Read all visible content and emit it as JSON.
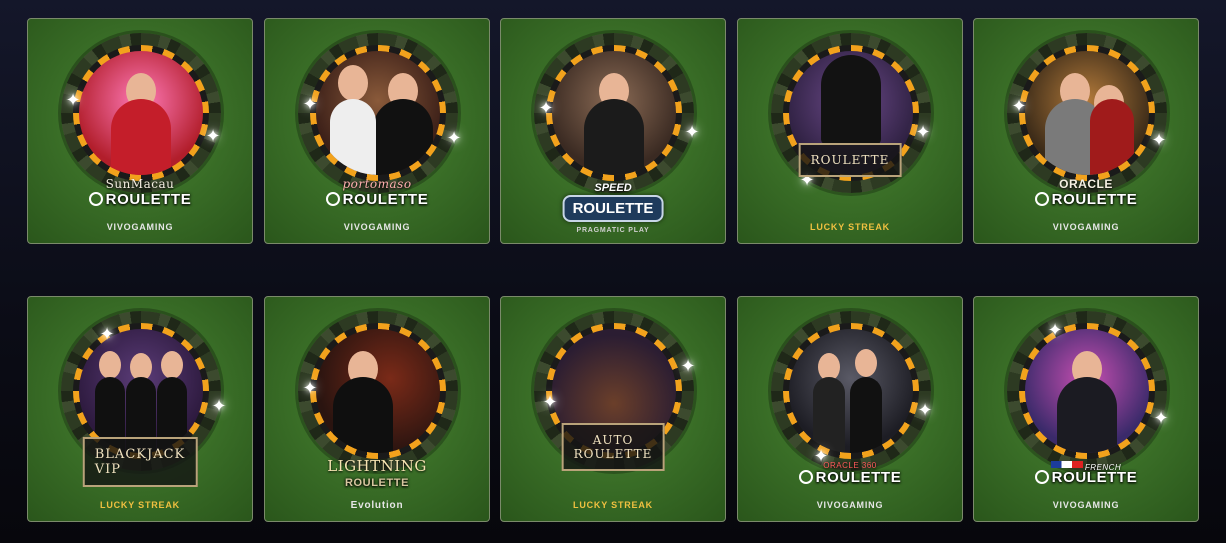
{
  "games": [
    {
      "title_top": "SunMacau",
      "title_main": "ROULETTE",
      "provider": "VIVOGAMING",
      "style": "plain",
      "photo_bg": "#b21e2b",
      "photo_bg2": "#ff7ab8"
    },
    {
      "title_top": "portomaso",
      "title_main": "ROULETTE",
      "provider": "VIVOGAMING",
      "style": "plain",
      "photo_bg": "#3b1f18",
      "photo_bg2": "#8a5a3a"
    },
    {
      "title_top": "SPEED",
      "title_main": "ROULETTE",
      "provider": "PRAGMATIC PLAY",
      "style": "badge",
      "photo_bg": "#3a2a22",
      "photo_bg2": "#8b6b55"
    },
    {
      "title_top": "",
      "title_main": "ROULETTE",
      "provider": "LUCKY STREAK",
      "style": "deco",
      "photo_bg": "#2f2142",
      "photo_bg2": "#6c4a8a"
    },
    {
      "title_top": "ORACLE",
      "title_main": "ROULETTE",
      "provider": "VIVOGAMING",
      "style": "plain",
      "photo_bg": "#3a2a18",
      "photo_bg2": "#b37a3a"
    },
    {
      "title_top": "",
      "title_main": "BLACKJACK VIP",
      "provider": "LUCKY STREAK",
      "style": "deco",
      "photo_bg": "#2d1a3e",
      "photo_bg2": "#5b3c78"
    },
    {
      "title_top": "LIGHTNING",
      "title_main": "ROULETTE",
      "provider": "Evolution",
      "style": "lightning",
      "photo_bg": "#2a1410",
      "photo_bg2": "#7a2a18"
    },
    {
      "title_top": "AUTO",
      "title_main": "ROULETTE",
      "provider": "LUCKY STREAK",
      "style": "deco",
      "photo_bg": "#2b1d32",
      "photo_bg2": "#6b3f2a"
    },
    {
      "title_top": "ORACLE 360",
      "title_main": "ROULETTE",
      "provider": "VIVOGAMING",
      "style": "plain",
      "photo_bg": "#1d1d24",
      "photo_bg2": "#5a5a66"
    },
    {
      "title_top": "FRENCH",
      "title_main": "ROULETTE",
      "provider": "VIVOGAMING",
      "style": "french",
      "photo_bg": "#3a2a6a",
      "photo_bg2": "#c84fb2"
    }
  ]
}
